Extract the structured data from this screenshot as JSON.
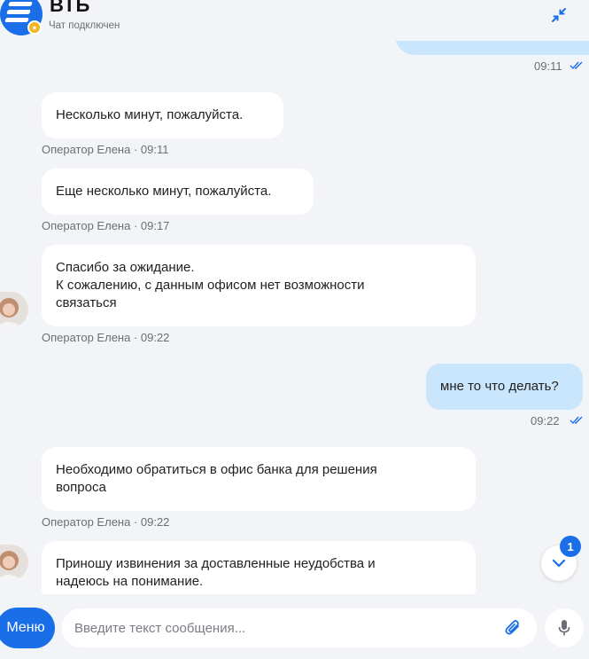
{
  "header": {
    "title": "ВТБ",
    "status": "Чат подключен"
  },
  "colors": {
    "brand": "#1a6fe8",
    "outgoing_bubble": "#c9e6fc",
    "incoming_bubble": "#ffffff",
    "background": "#f2f4f7",
    "read_ticks": "#1a6fe8"
  },
  "messages": [
    {
      "direction": "outgoing",
      "text": "",
      "time": "09:11",
      "status_icon": "double-check-icon"
    },
    {
      "direction": "incoming",
      "text": "Несколько минут, пожалуйста.",
      "meta": "Оператор Елена · 09:11"
    },
    {
      "direction": "incoming",
      "text": "Еще несколько минут, пожалуйста.",
      "meta": "Оператор Елена · 09:17"
    },
    {
      "direction": "incoming",
      "lines": [
        "Спасибо за ожидание.",
        "К сожалению, с данным офисом нет возможности",
        "связаться"
      ],
      "meta": "Оператор Елена · 09:22",
      "avatar": "operator-avatar"
    },
    {
      "direction": "outgoing",
      "text": "мне то что делать?",
      "time": "09:22",
      "status_icon": "double-check-icon"
    },
    {
      "direction": "incoming",
      "lines": [
        "Необходимо обратиться в офис банка для решения",
        "вопроса"
      ],
      "meta": "Оператор Елена · 09:22"
    },
    {
      "direction": "incoming",
      "lines": [
        "Приношу извинения за доставленные неудобства и",
        "надеюсь на понимание."
      ],
      "avatar": "operator-avatar"
    }
  ],
  "scroll_down": {
    "unread_count": "1",
    "icon": "chevron-down-icon"
  },
  "footer": {
    "menu_label": "Меню",
    "input_placeholder": "Введите текст сообщения...",
    "attach_icon": "paperclip-icon",
    "mic_icon": "microphone-icon"
  }
}
